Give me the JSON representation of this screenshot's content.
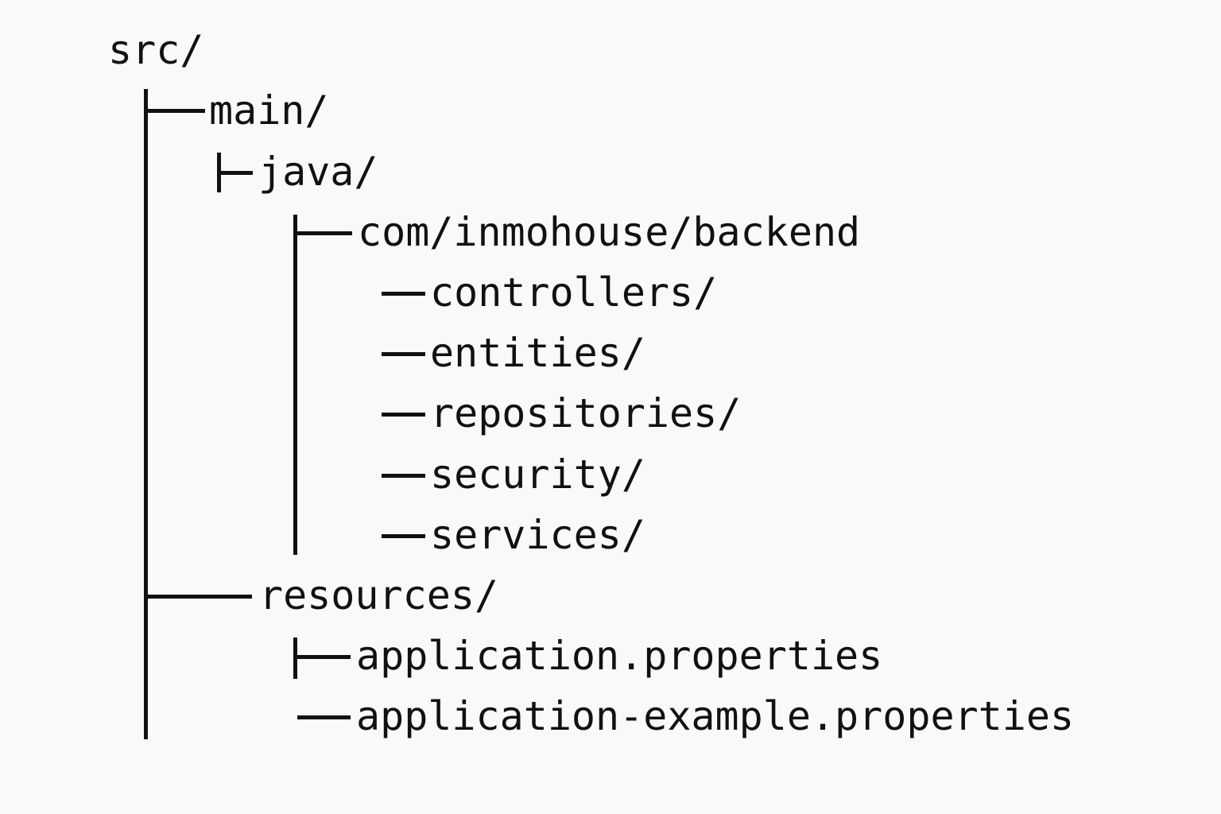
{
  "tree": {
    "root": "src/",
    "main": "main/",
    "java": "java/",
    "package": "com/inmohouse/backend",
    "packages": [
      "controllers/",
      "entities/",
      "repositories/",
      "security/",
      "services/"
    ],
    "resources": "resources/",
    "resource_files": [
      "application.properties",
      "application-example.properties"
    ]
  }
}
